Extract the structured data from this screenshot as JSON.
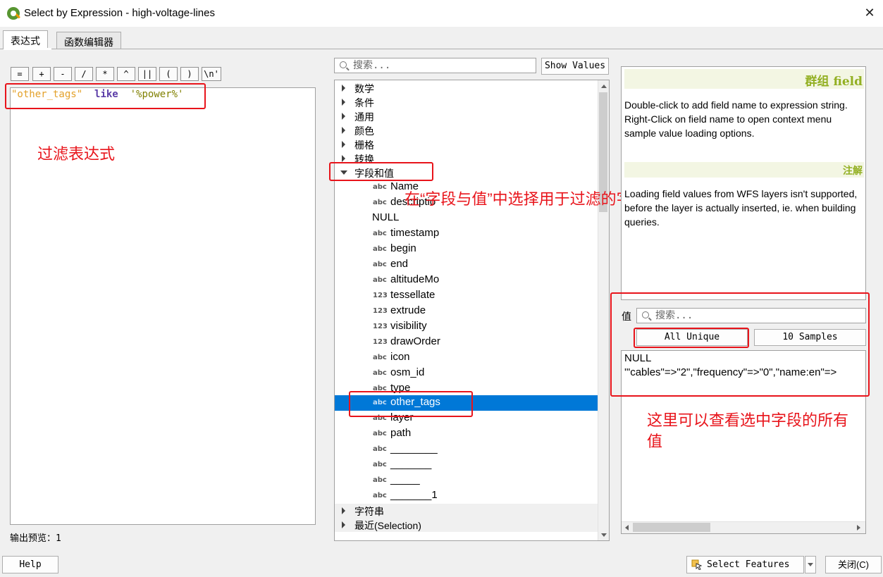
{
  "window": {
    "title": "Select by Expression - high-voltage-lines",
    "close_glyph": "✕"
  },
  "tabs": [
    {
      "label": "表达式",
      "active": true
    },
    {
      "label": "函数编辑器",
      "active": false
    }
  ],
  "operators": [
    "=",
    "+",
    "-",
    "/",
    "*",
    "^",
    "||",
    "(",
    ")",
    "\\n'"
  ],
  "expression": {
    "field": "\"other_tags\"",
    "keyword": "like",
    "string": "'%power%'"
  },
  "annotations": {
    "filter_expression": "过滤表达式",
    "choose_field": "在“字段与值”中选择用于过滤的字段",
    "view_values_line1": "这里可以查看选中字段的所有",
    "view_values_line2": "值"
  },
  "output_preview": "输出预览：1",
  "function_search": {
    "placeholder": "搜索..."
  },
  "show_values_label": "Show Values",
  "tree": {
    "groups_before": [
      "数学",
      "条件",
      "通用",
      "颜色",
      "栅格",
      "转换"
    ],
    "expanded_group": "字段和值",
    "fields": [
      {
        "type": "abc",
        "name": "Name"
      },
      {
        "type": "abc",
        "name": "descriptio"
      },
      {
        "type": "",
        "name": "NULL"
      },
      {
        "type": "abc",
        "name": "timestamp"
      },
      {
        "type": "abc",
        "name": "begin"
      },
      {
        "type": "abc",
        "name": "end"
      },
      {
        "type": "abc",
        "name": "altitudeMo"
      },
      {
        "type": "123",
        "name": "tessellate"
      },
      {
        "type": "123",
        "name": "extrude"
      },
      {
        "type": "123",
        "name": "visibility"
      },
      {
        "type": "123",
        "name": "drawOrder"
      },
      {
        "type": "abc",
        "name": "icon"
      },
      {
        "type": "abc",
        "name": "osm_id"
      },
      {
        "type": "abc",
        "name": "type"
      },
      {
        "type": "abc",
        "name": "other_tags",
        "selected": true
      },
      {
        "type": "abc",
        "name": "layer"
      },
      {
        "type": "abc",
        "name": "path"
      },
      {
        "type": "abc",
        "name": "________"
      },
      {
        "type": "abc",
        "name": "_______"
      },
      {
        "type": "abc",
        "name": "_____"
      },
      {
        "type": "abc",
        "name": "_______1"
      }
    ],
    "groups_after": [
      "字符串",
      "最近(Selection)"
    ]
  },
  "help": {
    "title": "群组 field",
    "body": "Double-click to add field name to expression string.\nRight-Click on field name to open context menu sample value loading options.",
    "note_title": "注解",
    "note_body": "Loading field values from WFS layers isn't supported, before the layer is actually inserted, ie. when building queries."
  },
  "values": {
    "label": "值",
    "search_placeholder": "搜索...",
    "all_unique_label": "All Unique",
    "samples_label": "10 Samples",
    "items": [
      "NULL",
      "'\"cables\"=>\"2\",\"frequency\"=>\"0\",\"name:en\"=>"
    ]
  },
  "footer": {
    "help_label": "Help",
    "select_features_label": "Select Features",
    "close_label": "关闭(C)"
  },
  "colors": {
    "accent_red": "#e8141b",
    "selection_blue": "#0078d7",
    "help_green": "#93b023"
  }
}
